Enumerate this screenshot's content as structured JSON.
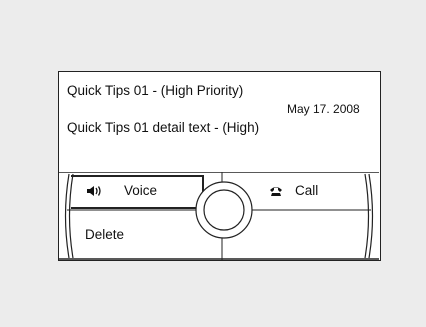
{
  "message": {
    "title": "Quick Tips 01 - (High Priority)",
    "date": "May 17. 2008",
    "detail": "Quick Tips 01 detail text - (High)"
  },
  "softkeys": {
    "voice_label": "Voice",
    "voice_icon": "speaker-icon",
    "call_label": "Call",
    "call_icon": "phone-handset-icon",
    "delete_label": "Delete"
  }
}
